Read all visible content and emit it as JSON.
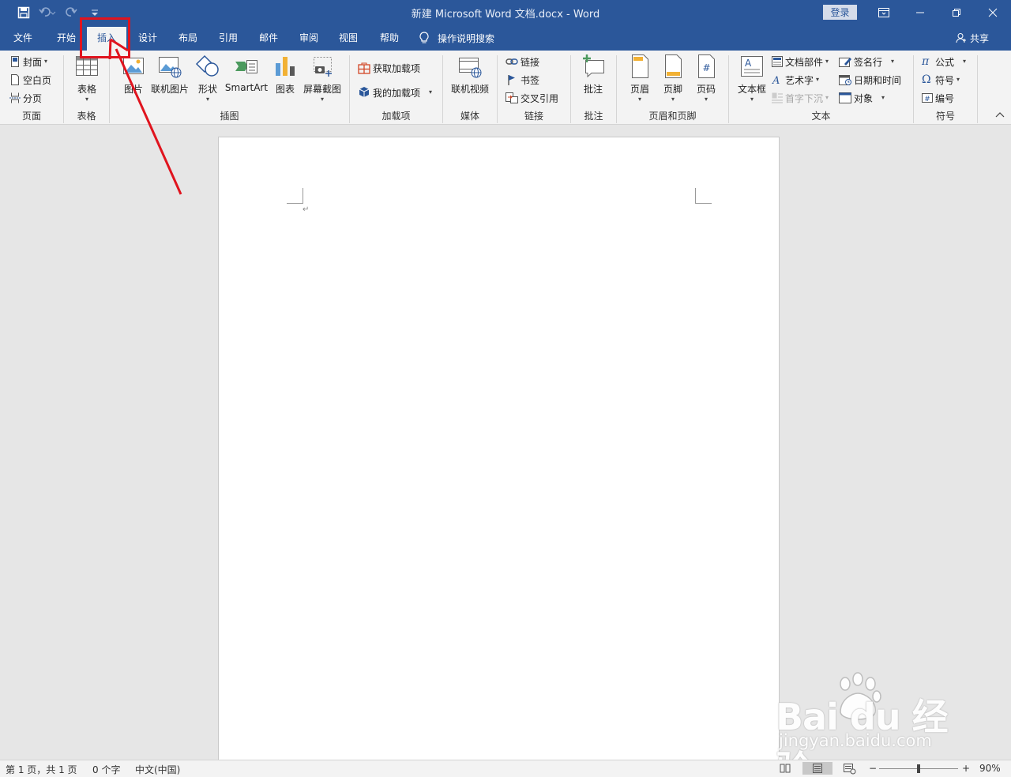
{
  "titlebar": {
    "title": "新建 Microsoft Word 文档.docx  -  Word",
    "login_label": "登录",
    "qat": {
      "save_icon": "save-icon",
      "undo_icon": "undo-icon",
      "redo_icon": "redo-icon",
      "customize_icon": "customize-icon"
    }
  },
  "tabs": [
    {
      "label": "文件"
    },
    {
      "label": "开始"
    },
    {
      "label": "插入"
    },
    {
      "label": "设计"
    },
    {
      "label": "布局"
    },
    {
      "label": "引用"
    },
    {
      "label": "邮件"
    },
    {
      "label": "审阅"
    },
    {
      "label": "视图"
    },
    {
      "label": "帮助"
    }
  ],
  "active_tab": "插入",
  "tell_me": "操作说明搜索",
  "share": "共享",
  "ribbon": {
    "pages": {
      "label": "页面",
      "cover": "封面",
      "blank": "空白页",
      "break": "分页"
    },
    "tables": {
      "label": "表格",
      "table": "表格"
    },
    "illustrations": {
      "label": "插图",
      "picture": "图片",
      "online_picture": "联机图片",
      "shapes": "形状",
      "smartart": "SmartArt",
      "chart": "图表",
      "screenshot": "屏幕截图"
    },
    "addins": {
      "label": "加载项",
      "get": "获取加载项",
      "my": "我的加载项"
    },
    "media": {
      "label": "媒体",
      "online_video": "联机视频"
    },
    "links": {
      "label": "链接",
      "link": "链接",
      "bookmark": "书签",
      "cross_ref": "交叉引用"
    },
    "comments": {
      "label": "批注",
      "comment": "批注"
    },
    "header_footer": {
      "label": "页眉和页脚",
      "header": "页眉",
      "footer": "页脚",
      "page_number": "页码"
    },
    "text": {
      "label": "文本",
      "textbox": "文本框",
      "quick_parts": "文档部件",
      "wordart": "艺术字",
      "dropcap": "首字下沉",
      "signature": "签名行",
      "datetime": "日期和时间",
      "object": "对象"
    },
    "symbols": {
      "label": "符号",
      "equation": "公式",
      "symbol": "符号",
      "number": "编号"
    }
  },
  "statusbar": {
    "page": "第 1 页，共 1 页",
    "words": "0 个字",
    "language": "中文(中国)",
    "zoom_minus": "−",
    "zoom_plus": "+",
    "zoom": "90%",
    "zoom_fraction": 0.5
  },
  "watermark": {
    "brand": "Bai du 经验",
    "url": "jingyan.baidu.com"
  },
  "colors": {
    "accent": "#2b579a",
    "annotation": "#e0141e"
  }
}
